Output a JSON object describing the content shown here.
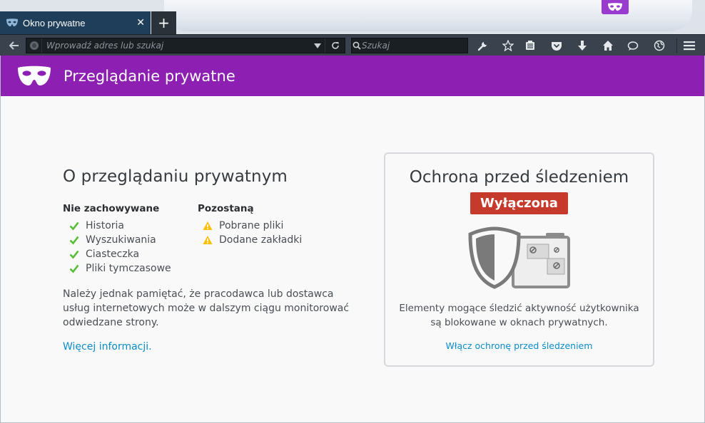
{
  "tab": {
    "title": "Okno prywatne",
    "close": "✕"
  },
  "newtab_label": "+",
  "navbar": {
    "url_placeholder": "Wprowadź adres lub szukaj",
    "search_placeholder": "Szukaj"
  },
  "banner": {
    "title": "Przeglądanie prywatne"
  },
  "about": {
    "heading": "O przeglądaniu prywatnym",
    "not_saved": {
      "title": "Nie zachowywane",
      "items": [
        "Historia",
        "Wyszukiwania",
        "Ciasteczka",
        "Pliki tymczasowe"
      ]
    },
    "saved": {
      "title": "Pozostaną",
      "items": [
        "Pobrane pliki",
        "Dodane zakładki"
      ]
    },
    "note": "Należy jednak pamiętać, że pracodawca lub dostawca usług internetowych może w dalszym ciągu monitorować odwiedzane strony.",
    "learn_more": "Więcej informacji."
  },
  "tracking": {
    "title": "Ochrona przed śledzeniem",
    "status": "Wyłączona",
    "description": "Elementy mogące śledzić aktywność użytkownika są blokowane w oknach prywatnych.",
    "action": "Włącz ochronę przed śledzeniem"
  },
  "colors": {
    "accent_purple": "#8d1fb2",
    "status_red": "#c63a2c",
    "link_blue": "#0a8dc9",
    "check_green": "#57bd35",
    "warning_yellow": "#ffbf00"
  },
  "icons": {
    "tab": "private-mask-icon",
    "toolbar": [
      "back-arrow-icon",
      "site-identity-icon",
      "dropdown-arrow-icon",
      "reload-icon",
      "search-icon",
      "wrench-icon",
      "star-icon",
      "reading-list-icon",
      "pocket-icon",
      "download-icon",
      "home-icon",
      "chat-icon",
      "globe-icon",
      "hamburger-menu-icon"
    ]
  }
}
